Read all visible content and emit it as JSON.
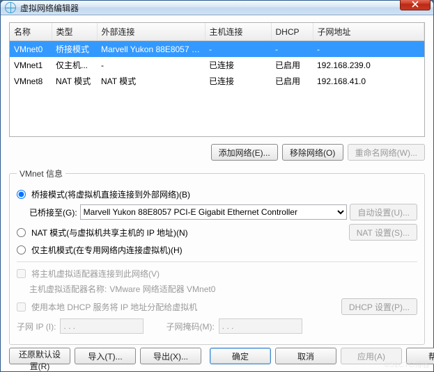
{
  "title": "虚拟网络编辑器",
  "columns": {
    "name": "名称",
    "type": "类型",
    "ext": "外部连接",
    "host": "主机连接",
    "dhcp": "DHCP",
    "subnet": "子网地址"
  },
  "rows": [
    {
      "name": "VMnet0",
      "type": "桥接模式",
      "ext": "Marvell Yukon 88E8057 PCI-...",
      "host": "-",
      "dhcp": "-",
      "subnet": "-"
    },
    {
      "name": "VMnet1",
      "type": "仅主机...",
      "ext": "-",
      "host": "已连接",
      "dhcp": "已启用",
      "subnet": "192.168.239.0"
    },
    {
      "name": "VMnet8",
      "type": "NAT 模式",
      "ext": "NAT 模式",
      "host": "已连接",
      "dhcp": "已启用",
      "subnet": "192.168.41.0"
    }
  ],
  "buttons": {
    "add": "添加网络(E)...",
    "remove": "移除网络(O)",
    "rename": "重命名网络(W)...",
    "auto": "自动设置(U)...",
    "nat": "NAT 设置(S)...",
    "dhcp": "DHCP 设置(P)...",
    "restore": "还原默认设置(R)",
    "import": "导入(T)...",
    "export": "导出(X)...",
    "ok": "确定",
    "cancel": "取消",
    "apply": "应用(A)",
    "help": "帮助"
  },
  "info": {
    "legend": "VMnet 信息",
    "radio_bridge": "桥接模式(将虚拟机直接连接到外部网络)(B)",
    "bridge_to": "已桥接至(G):",
    "bridge_adapter": "Marvell Yukon 88E8057 PCI-E Gigabit Ethernet Controller",
    "radio_nat": "NAT 模式(与虚拟机共享主机的 IP 地址)(N)",
    "radio_host": "仅主机模式(在专用网络内连接虚拟机)(H)",
    "chk_connect": "将主机虚拟适配器连接到此网络(V)",
    "adapter_name_lbl": "主机虚拟适配器名称:",
    "adapter_name_val": "VMware 网络适配器 VMnet0",
    "chk_dhcp": "使用本地 DHCP 服务将 IP 地址分配给虚拟机",
    "subnet_ip_lbl": "子网 IP (I):",
    "subnet_mask_lbl": "子网掩码(M):",
    "subnet_ip_val": ". . .",
    "subnet_mask_val": ". . ."
  },
  "watermark": "©51CTO博客"
}
